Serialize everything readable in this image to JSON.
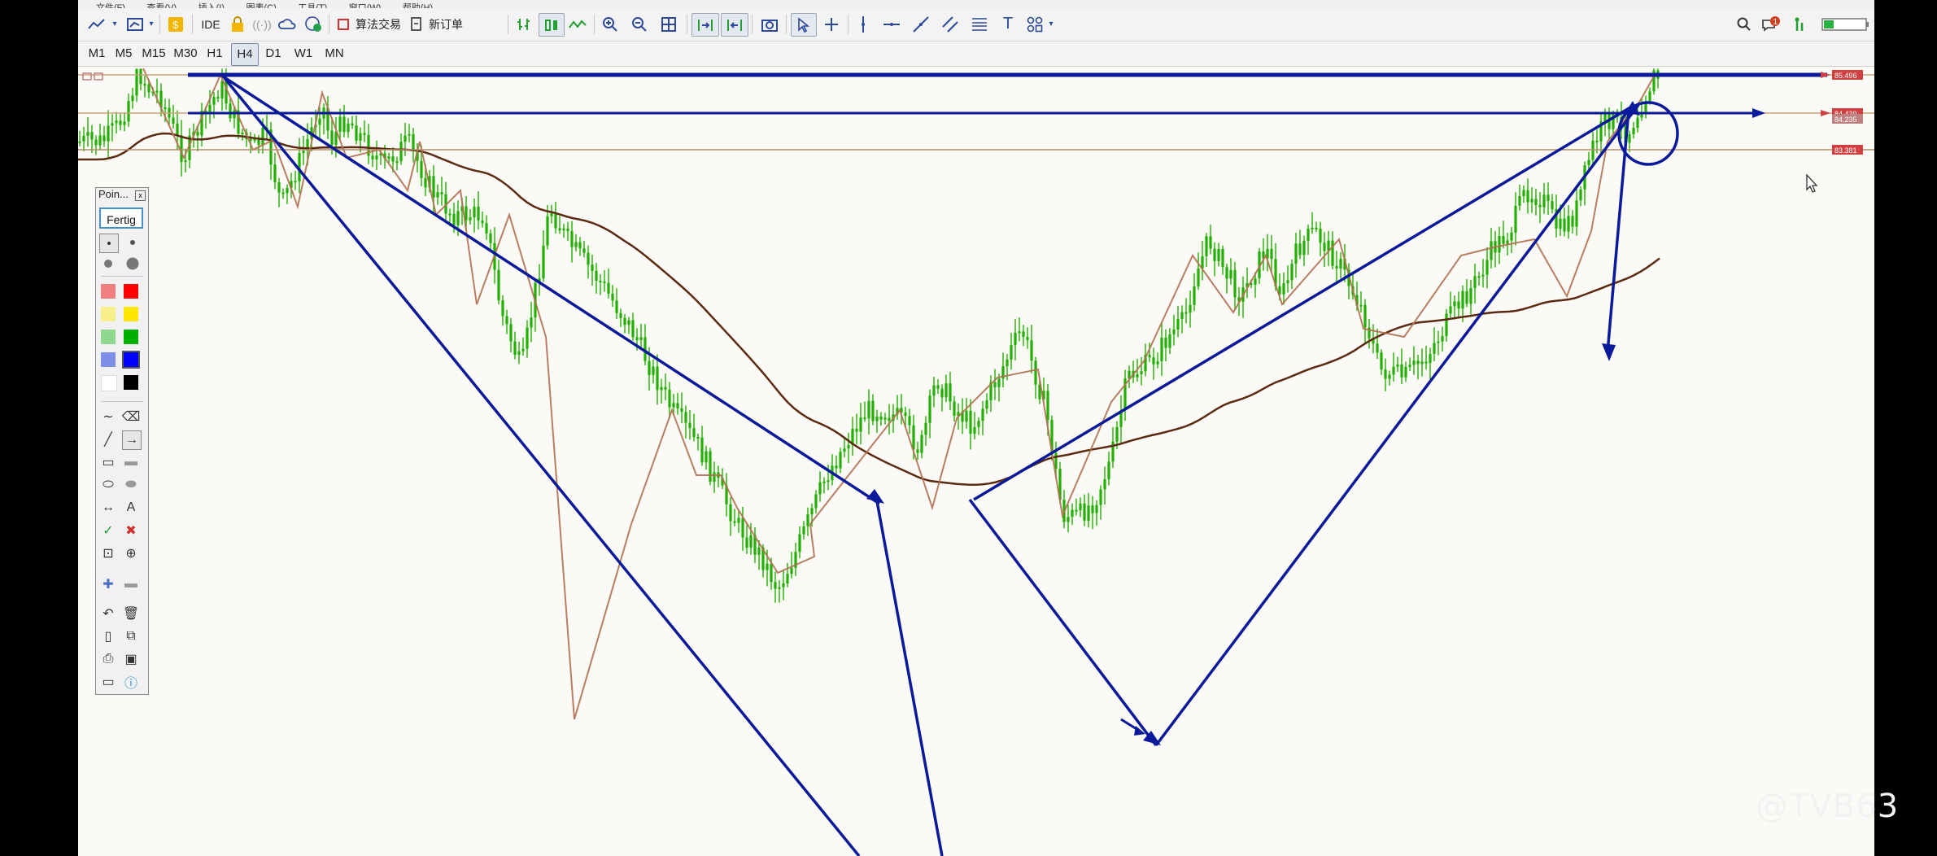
{
  "menu": {
    "items": [
      "文件(F)",
      "查看(V)",
      "插入(I)",
      "图表(C)",
      "工具(T)",
      "窗口(W)",
      "帮助(H)"
    ]
  },
  "toolbar": {
    "icons": [
      "line-chart-icon",
      "chart-template-icon",
      "dollar-icon",
      "ide-label",
      "lock-icon",
      "signal-icon",
      "cloud-icon",
      "globe-icon",
      "algo-trading-icon",
      "new-order-icon",
      "bar-chart-icon",
      "candle-chart-icon",
      "line-type-icon",
      "zoom-in-icon",
      "zoom-out-icon",
      "grid-icon",
      "autoscroll-icon",
      "chart-shift-icon",
      "screenshot-icon",
      "cursor-icon",
      "crosshair-icon",
      "vertical-line-icon",
      "horizontal-line-icon",
      "trendline-icon",
      "channel-icon",
      "fibonacci-icon",
      "text-icon",
      "shapes-icon",
      "search-icon",
      "notification-icon",
      "signal-strength-icon",
      "battery-icon"
    ],
    "ide_label": "IDE",
    "algo_trading_label": "算法交易",
    "new_order_label": "新订单",
    "notification_count": "1"
  },
  "timeframes": {
    "items": [
      "M1",
      "M5",
      "M15",
      "M30",
      "H1",
      "H4",
      "D1",
      "W1",
      "MN"
    ],
    "active": "H4"
  },
  "palette": {
    "title": "Poin...",
    "close": "x",
    "done_label": "Fertig",
    "colors": [
      "#f08080",
      "#ff0000",
      "#f7f08a",
      "#ffe600",
      "#8fd88f",
      "#00b000",
      "#7f8fe8",
      "#0000ff",
      "#ffffff",
      "#000000"
    ],
    "tools": [
      "freehand-icon",
      "eraser-icon",
      "line-icon",
      "arrow-line-icon",
      "rectangle-outline-icon",
      "rectangle-fill-icon",
      "ellipse-outline-icon",
      "ellipse-fill-icon",
      "double-arrow-icon",
      "text-icon",
      "check-icon",
      "cross-icon",
      "crop-icon",
      "zoom-icon",
      "plus-icon",
      "minus-icon",
      "undo-icon",
      "trash-icon",
      "new-file-icon",
      "copy-icon",
      "print-icon",
      "save-icon",
      "screen-icon",
      "info-icon"
    ],
    "text_tool": "A",
    "accent": "#4a90c8"
  },
  "chart": {
    "price_labels": [
      {
        "value": "85.496",
        "color": "#d04040"
      },
      {
        "value": "84.439",
        "color": "#d04040"
      },
      {
        "value": "84.235",
        "color": "#c08080"
      },
      {
        "value": "83.381",
        "color": "#d04040"
      }
    ],
    "candle_color": "#22b000",
    "ma_fast_color": "#5c2a10",
    "ma_slow_color": "#b03090",
    "drawing_color": "#0a1a9a",
    "zigzag_color": "#b07050"
  },
  "watermark": "@TVB63"
}
